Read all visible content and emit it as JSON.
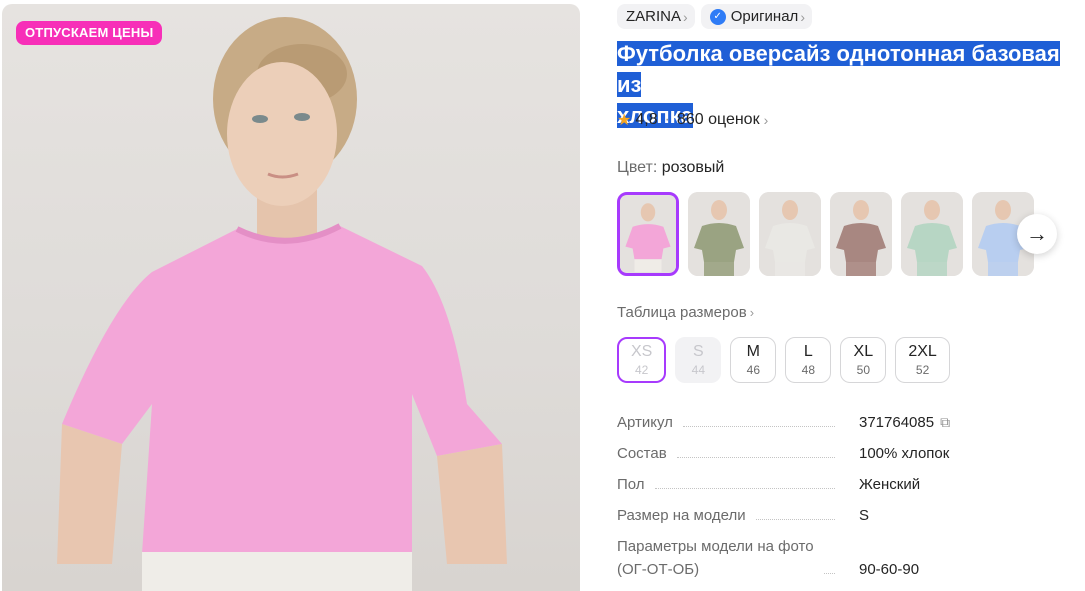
{
  "promo_badge": "ОТПУСКАЕМ ЦЕНЫ",
  "brand_chip": {
    "label": "ZARINA",
    "icon": "chevron-right-icon"
  },
  "original_chip": {
    "label": "Оригинал",
    "icon": "verified-check-icon"
  },
  "product": {
    "title_line1": "Футболка оверсайз однотонная базовая из",
    "title_line2": "хлопка"
  },
  "rating": {
    "value": "4,8",
    "separator": "·",
    "reviews": "860 оценок"
  },
  "color": {
    "label": "Цвет:",
    "value": "розовый"
  },
  "color_swatches": [
    {
      "name": "розовый",
      "color": "#f3a6d8",
      "selected": true
    },
    {
      "name": "оливковый",
      "color": "#9aa382"
    },
    {
      "name": "светло-серый",
      "color": "#e9e8e4"
    },
    {
      "name": "коричневый",
      "color": "#a88781"
    },
    {
      "name": "мятный",
      "color": "#b7d6c4"
    },
    {
      "name": "голубой",
      "color": "#b8cef0"
    }
  ],
  "size_table_link": "Таблица размеров",
  "sizes": [
    {
      "label": "XS",
      "ru": "42",
      "state": "selected"
    },
    {
      "label": "S",
      "ru": "44",
      "state": "disabled"
    },
    {
      "label": "M",
      "ru": "46",
      "state": "available"
    },
    {
      "label": "L",
      "ru": "48",
      "state": "available"
    },
    {
      "label": "XL",
      "ru": "50",
      "state": "available"
    },
    {
      "label": "2XL",
      "ru": "52",
      "state": "available"
    }
  ],
  "params": [
    {
      "key": "Артикул",
      "value": "371764085"
    },
    {
      "key": "Состав",
      "value": "100% хлопок"
    },
    {
      "key": "Пол",
      "value": "Женский"
    },
    {
      "key": "Размер на модели",
      "value": "S"
    },
    {
      "key_line1": "Параметры модели на фото",
      "key_line2": "(ОГ-ОТ-ОБ)",
      "value": "90-60-90"
    }
  ],
  "colors": {
    "accent": "#a73afd",
    "badge": "#f72fb8",
    "selection": "#1f5fd6",
    "star": "#f5a623",
    "verified": "#2f7cf6",
    "tshirt_pink": "#f3a6d8"
  }
}
